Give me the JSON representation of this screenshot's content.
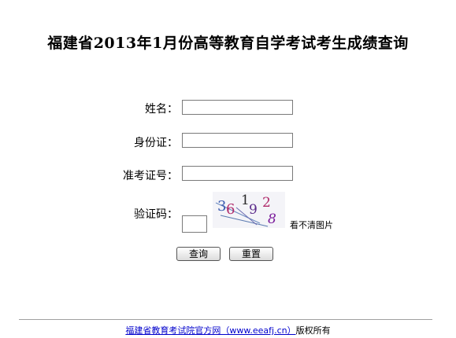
{
  "page": {
    "title": "福建省2013年1月份高等教育自学考试考生成绩查询"
  },
  "form": {
    "name_label": "姓名：",
    "id_label": "身份证：",
    "exam_no_label": "准考证号：",
    "captcha_label": "验证码：",
    "name_value": "",
    "id_value": "",
    "exam_no_value": "",
    "captcha_value": "",
    "captcha_chars": [
      "3",
      "6",
      "1",
      "9",
      "2",
      "8"
    ],
    "captcha_colors": [
      "#3b5bb0",
      "#b02a6a",
      "#2a2a2a",
      "#5a2a8a",
      "#b02a6a",
      "#7a1a9a"
    ],
    "refresh_label": "看不清图片",
    "query_button": "查询",
    "reset_button": "重置"
  },
  "footer": {
    "link_text": "福建省教育考试院官方网（www.eeafj.cn）",
    "suffix_text": "版权所有"
  }
}
